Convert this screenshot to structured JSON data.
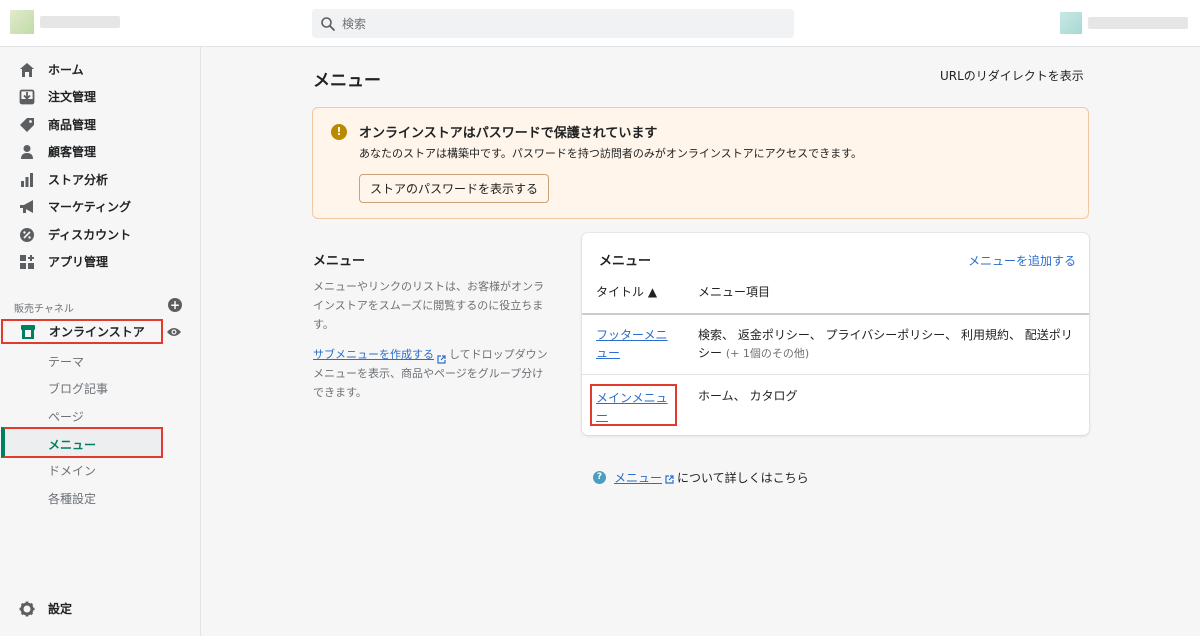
{
  "header": {
    "search_placeholder": "検索"
  },
  "sidebar": {
    "items": [
      {
        "label": "ホーム",
        "icon": "home-icon"
      },
      {
        "label": "注文管理",
        "icon": "orders-icon"
      },
      {
        "label": "商品管理",
        "icon": "tag-icon"
      },
      {
        "label": "顧客管理",
        "icon": "customer-icon"
      },
      {
        "label": "ストア分析",
        "icon": "analytics-icon"
      },
      {
        "label": "マーケティング",
        "icon": "megaphone-icon"
      },
      {
        "label": "ディスカウント",
        "icon": "discount-icon"
      },
      {
        "label": "アプリ管理",
        "icon": "apps-icon"
      }
    ],
    "channels_label": "販売チャネル",
    "online_store_label": "オンラインストア",
    "sub_items": [
      "テーマ",
      "ブログ記事",
      "ページ",
      "メニュー",
      "ドメイン",
      "各種設定"
    ],
    "settings_label": "設定"
  },
  "main": {
    "title": "メニュー",
    "redirect_link": "URLのリダイレクトを表示",
    "banner": {
      "title": "オンラインストアはパスワードで保護されています",
      "text": "あなたのストアは構築中です。パスワードを持つ訪問者のみがオンラインストアにアクセスできます。",
      "button": "ストアのパスワードを表示する"
    },
    "aside": {
      "title": "メニュー",
      "text": "メニューやリンクのリストは、お客様がオンラインストアをスムーズに閲覧するのに役立ちます。",
      "link": "サブメニューを作成する",
      "text2": "してドロップダウンメニューを表示、商品やページをグループ分けできます。"
    },
    "card": {
      "title": "メニュー",
      "add_link": "メニューを追加する",
      "col_title": "タイトル ▲",
      "col_items": "メニュー項目",
      "rows": [
        {
          "title": "フッターメニュー",
          "items": "検索、 返金ポリシー、 プライバシーポリシー、 利用規約、 配送ポリシー",
          "more": "(+ 1個のその他)"
        },
        {
          "title": "メインメニュー",
          "items": "ホーム、 カタログ"
        }
      ]
    },
    "learn": {
      "link": "メニュー",
      "text": "について詳しくはこちら"
    }
  },
  "colors": {
    "accent_green": "#008060",
    "link_blue": "#2c6ecb",
    "highlight_red": "#e23b2e",
    "banner_bg": "#fff5ea"
  }
}
